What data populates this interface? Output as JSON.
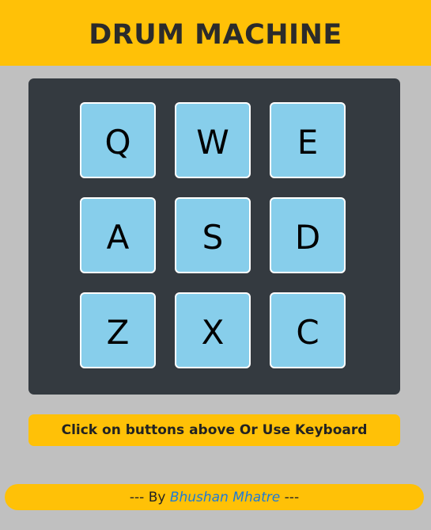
{
  "header": {
    "title": "DRUM MACHINE"
  },
  "pads": [
    {
      "key": "Q"
    },
    {
      "key": "W"
    },
    {
      "key": "E"
    },
    {
      "key": "A"
    },
    {
      "key": "S"
    },
    {
      "key": "D"
    },
    {
      "key": "Z"
    },
    {
      "key": "X"
    },
    {
      "key": "C"
    }
  ],
  "info": {
    "text": "Click on buttons above Or Use Keyboard"
  },
  "footer": {
    "prefix": "--- By ",
    "author": "Bhushan Mhatre",
    "suffix": " ---"
  },
  "colors": {
    "accent": "#ffc107",
    "background": "#c0c0c0",
    "panel": "#343a40",
    "pad": "#87ceeb",
    "link": "#1e7bd6"
  }
}
